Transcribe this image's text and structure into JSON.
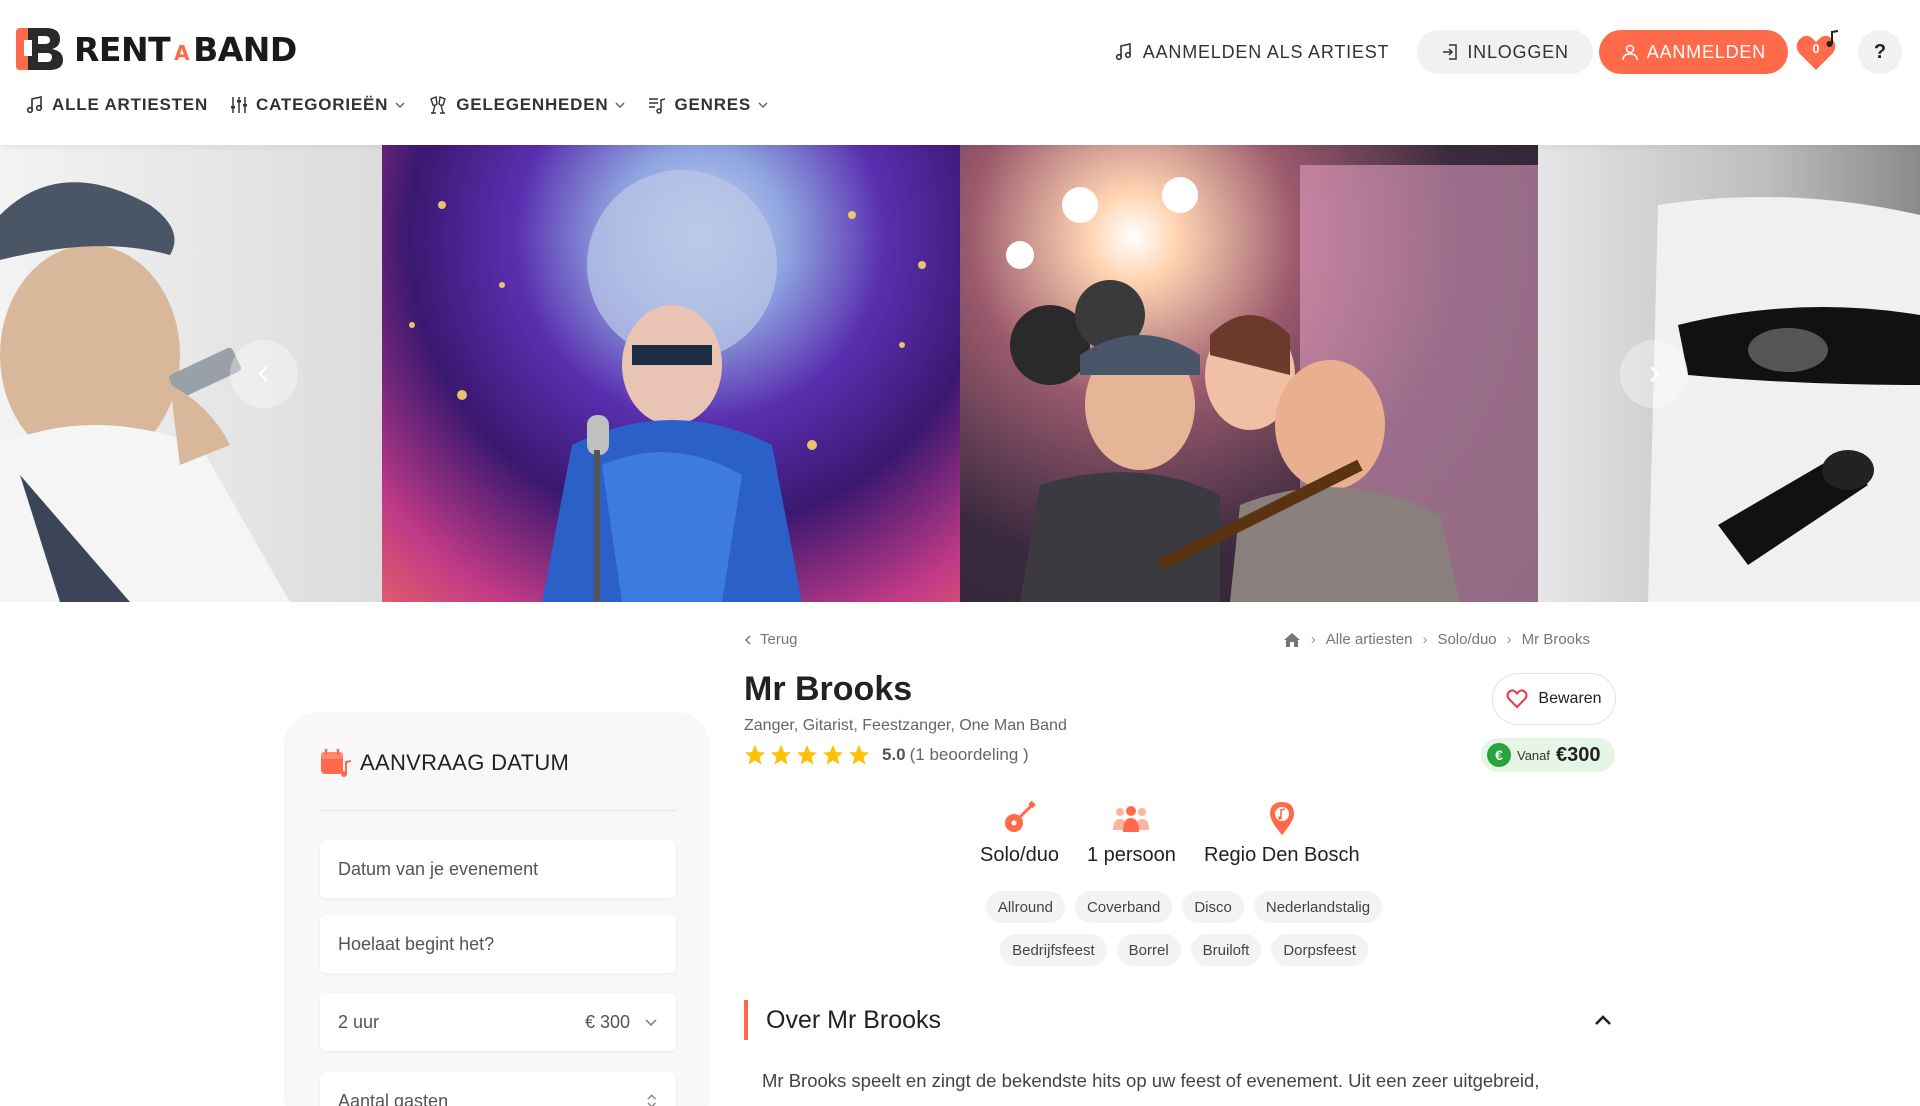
{
  "header": {
    "logo_left": "RENT",
    "logo_a": "A",
    "logo_right": "BAND",
    "artist_signup": "AANMELDEN ALS ARTIEST",
    "login": "INLOGGEN",
    "register": "AANMELDEN",
    "favorites_count": "0",
    "help": "?"
  },
  "nav": {
    "all_artists": "ALLE ARTIESTEN",
    "categories": "CATEGORIEËN",
    "occasions": "GELEGENHEDEN",
    "genres": "GENRES"
  },
  "breadcrumb": {
    "back": "Terug",
    "items": [
      "Alle artiesten",
      "Solo/duo",
      "Mr Brooks"
    ]
  },
  "artist": {
    "name": "Mr Brooks",
    "roles": "Zanger, Gitarist, Feestzanger, One Man Band",
    "rating_score": "5.0",
    "rating_count": "(1 beoordeling )",
    "stars": 5,
    "save_label": "Bewaren",
    "price_prefix": "Vanaf",
    "price": "€300",
    "price_icon": "€"
  },
  "features": [
    {
      "label": "Solo/duo",
      "icon": "guitar-icon"
    },
    {
      "label": "1 persoon",
      "icon": "people-icon"
    },
    {
      "label": "Regio Den Bosch",
      "icon": "location-icon"
    }
  ],
  "genre_tags": [
    "Allround",
    "Coverband",
    "Disco",
    "Nederlandstalig"
  ],
  "occasion_tags": [
    "Bedrijfsfeest",
    "Borrel",
    "Bruiloft",
    "Dorpsfeest"
  ],
  "booking": {
    "title": "AANVRAAG DATUM",
    "date_placeholder": "Datum van je evenement",
    "time_placeholder": "Hoelaat begint het?",
    "duration_value": "2 uur",
    "duration_price": "€ 300",
    "guests_placeholder": "Aantal gasten"
  },
  "about": {
    "title": "Over Mr Brooks",
    "text": "Mr Brooks speelt en zingt de bekendste hits op uw feest of evenement. Uit een zeer uitgebreid,"
  },
  "colors": {
    "accent": "#ff6b4a",
    "price_green": "#29a43a"
  }
}
